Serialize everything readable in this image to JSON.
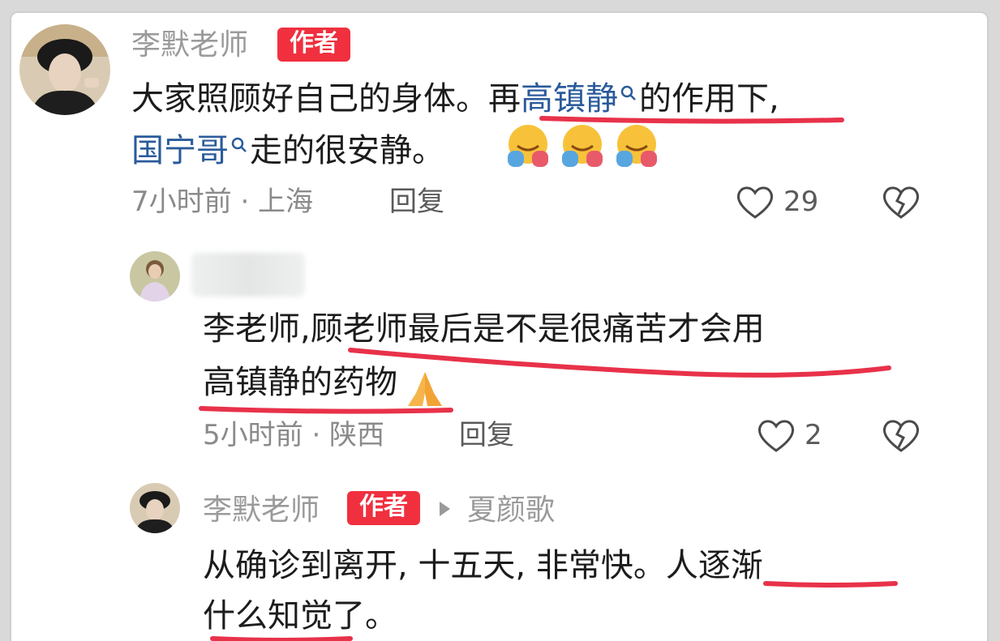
{
  "accent_red": "#f0303f",
  "link_color": "#2a5b9b",
  "comment1": {
    "author": "李默老师",
    "badge": "作者",
    "line1_a": "大家照顾好自己的身体。",
    "line1_b": "再",
    "line1_link": "高镇静",
    "line1_c": "的作用下,",
    "line2_link": "国宁哥",
    "line2_c": "走的很安静。",
    "emoji_icon": "hugging-face-icon",
    "meta": "7小时前 · 上海",
    "reply_label": "回复",
    "like_count": "29"
  },
  "comment2": {
    "line1": "李老师,顾老师最后是不是很痛苦才会用",
    "line2": "高镇静的药物",
    "emoji_icon": "folded-hands-icon",
    "meta": "5小时前 · 陕西",
    "reply_label": "回复",
    "like_count": "2"
  },
  "comment3": {
    "author": "李默老师",
    "badge": "作者",
    "reply_to": "夏颜歌",
    "line1": "从确诊到离开, 十五天, 非常快。人逐渐",
    "line2": "什么知觉了。"
  }
}
